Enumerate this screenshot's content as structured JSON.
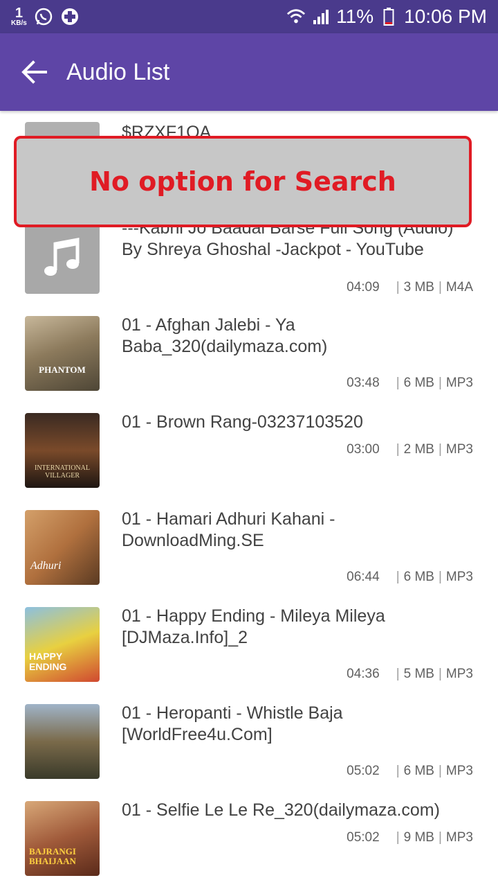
{
  "status_bar": {
    "net_speed_value": "1",
    "net_speed_unit": "KB/s",
    "battery_percent": "11%",
    "time": "10:06 PM",
    "icons": [
      "whatsapp-icon",
      "plus-icon",
      "wifi-icon",
      "signal-icon",
      "battery-icon"
    ]
  },
  "app_bar": {
    "title": "Audio List",
    "back_icon": "arrow-back-icon"
  },
  "overlay": {
    "text": "No option for Search"
  },
  "songs": [
    {
      "title": "$RZXF1OA",
      "duration": "",
      "size": "",
      "format": ""
    },
    {
      "title": "---Kabhi Jo Baadal Barse Full Song (Audio) By Shreya Ghoshal -Jackpot - YouTube",
      "duration": "04:09",
      "size": "3 MB",
      "format": "M4A",
      "thumb": "music-note-icon"
    },
    {
      "title": "01 - Afghan Jalebi - Ya Baba_320(dailymaza.com)",
      "duration": "03:48",
      "size": "6 MB",
      "format": "MP3",
      "art_text": "PHANTOM"
    },
    {
      "title": "01 - Brown Rang-03237103520",
      "duration": "03:00",
      "size": "2 MB",
      "format": "MP3",
      "art_text": "INTERNATIONAL VILLAGER"
    },
    {
      "title": "01 - Hamari Adhuri Kahani - DownloadMing.SE",
      "duration": "06:44",
      "size": "6 MB",
      "format": "MP3",
      "art_text": "Adhuri"
    },
    {
      "title": "01 - Happy Ending - Mileya Mileya [DJMaza.Info]_2",
      "duration": "04:36",
      "size": "5 MB",
      "format": "MP3",
      "art_text": "HAPPY ENDING"
    },
    {
      "title": "01 - Heropanti - Whistle Baja [WorldFree4u.Com]",
      "duration": "05:02",
      "size": "6 MB",
      "format": "MP3"
    },
    {
      "title": "01 - Selfie Le Le Re_320(dailymaza.com)",
      "duration": "05:02",
      "size": "9 MB",
      "format": "MP3",
      "art_text": "BAJRANGI BHAIJAAN"
    }
  ],
  "colors": {
    "status_bar": "#4a3a8c",
    "app_bar": "#5e45a6",
    "overlay_bg": "#c7c7c7",
    "overlay_accent": "#e01b24"
  }
}
